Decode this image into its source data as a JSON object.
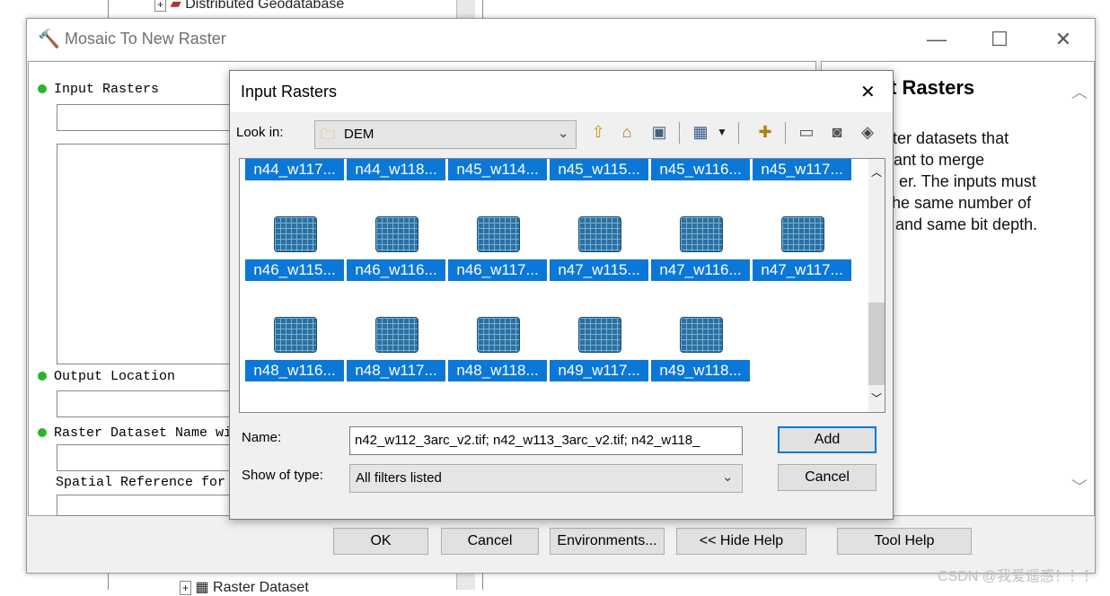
{
  "background": {
    "tree_top_item": "Distributed Geodatabase",
    "tree_bottom_item": "Raster Dataset"
  },
  "main_window": {
    "title": "Mosaic To New Raster",
    "minimize_glyph": "—",
    "maximize_glyph": "☐",
    "close_glyph": "✕",
    "fields": {
      "input_rasters_label": "Input Rasters",
      "output_location_label": "Output Location",
      "raster_name_label": "Raster Dataset Name wi",
      "spatial_ref_label": "Spatial Reference for"
    },
    "help": {
      "heading": "t Rasters",
      "lines": [
        "ster datasets that",
        "ant to merge",
        "er. The inputs must",
        "he same number of",
        "and same bit depth."
      ]
    },
    "buttons": {
      "ok": "OK",
      "cancel": "Cancel",
      "environments": "Environments...",
      "hide_help": "<< Hide Help",
      "tool_help": "Tool Help"
    }
  },
  "dialog": {
    "title": "Input Rasters",
    "close_glyph": "✕",
    "look_in_label": "Look in:",
    "look_in_value": "DEM",
    "name_label": "Name:",
    "name_value": "n42_w112_3arc_v2.tif; n42_w113_3arc_v2.tif; n42_w118_",
    "type_label": "Show of type:",
    "type_value": "All filters listed",
    "add_button": "Add",
    "cancel_button": "Cancel",
    "rows": [
      {
        "icons": false,
        "items": [
          "n44_w117...",
          "n44_w118...",
          "n45_w114...",
          "n45_w115...",
          "n45_w116...",
          "n45_w117..."
        ]
      },
      {
        "icons": true,
        "items": [
          "n46_w115...",
          "n46_w116...",
          "n46_w117...",
          "n47_w115...",
          "n47_w116...",
          "n47_w117..."
        ]
      },
      {
        "icons": true,
        "items": [
          "n48_w116...",
          "n48_w117...",
          "n48_w118...",
          "n49_w117...",
          "n49_w118..."
        ]
      }
    ]
  },
  "watermark": "CSDN @我爱遥感！！！"
}
